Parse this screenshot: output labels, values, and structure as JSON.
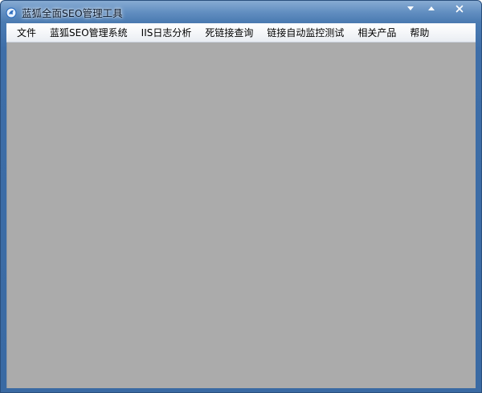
{
  "window": {
    "title": "蓝狐全面SEO管理工具",
    "controls": {
      "minimize_icon": "triangle-down-icon",
      "maximize_icon": "triangle-up-icon",
      "close_icon": "x-icon",
      "close_glyph": "X"
    }
  },
  "menu": {
    "items": [
      {
        "label": "文件"
      },
      {
        "label": "蓝狐SEO管理系统"
      },
      {
        "label": "IIS日志分析"
      },
      {
        "label": "死链接查询"
      },
      {
        "label": "链接自动监控测试"
      },
      {
        "label": "相关产品"
      },
      {
        "label": "帮助"
      }
    ]
  },
  "colors": {
    "frame": "#3e6ea8",
    "menubar": "#f3f5f8",
    "client_area": "#ababab"
  }
}
